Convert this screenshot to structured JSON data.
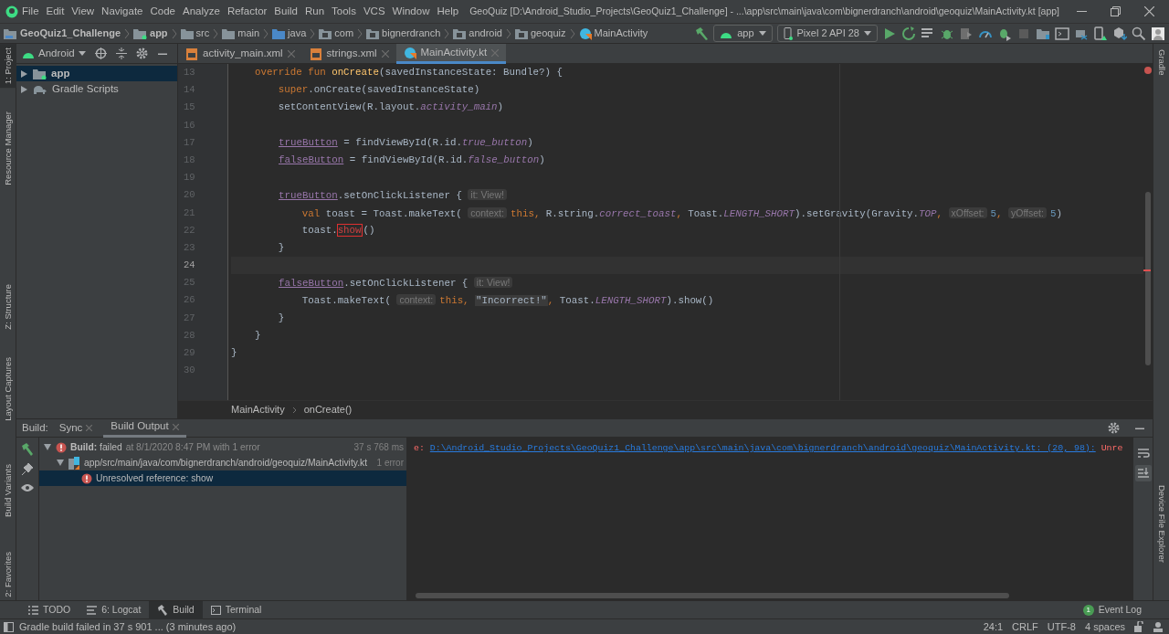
{
  "window": {
    "title": "GeoQuiz [D:\\Android_Studio_Projects\\GeoQuiz1_Challenge] - ...\\app\\src\\main\\java\\com\\bignerdranch\\android\\geoquiz\\MainActivity.kt [app]"
  },
  "menu": [
    "File",
    "Edit",
    "View",
    "Navigate",
    "Code",
    "Analyze",
    "Refactor",
    "Build",
    "Run",
    "Tools",
    "VCS",
    "Window",
    "Help"
  ],
  "navigation_bar": {
    "path": [
      {
        "label": "GeoQuiz1_Challenge",
        "kind": "project"
      },
      {
        "label": "app",
        "kind": "module"
      },
      {
        "label": "src",
        "kind": "folder"
      },
      {
        "label": "main",
        "kind": "folder"
      },
      {
        "label": "java",
        "kind": "source"
      },
      {
        "label": "com",
        "kind": "package"
      },
      {
        "label": "bignerdranch",
        "kind": "package"
      },
      {
        "label": "android",
        "kind": "package"
      },
      {
        "label": "geoquiz",
        "kind": "package"
      },
      {
        "label": "MainActivity",
        "kind": "class"
      }
    ],
    "run_configuration": "app",
    "device": "Pixel 2 API 28"
  },
  "left_tool_windows": [
    {
      "label": "1: Project",
      "selected": true
    },
    {
      "label": "Resource Manager",
      "selected": false
    },
    {
      "label": "Z: Structure",
      "selected": false
    },
    {
      "label": "Layout Captures",
      "selected": false
    },
    {
      "label": "Build Variants",
      "selected": false
    },
    {
      "label": "2: Favorites",
      "selected": false
    }
  ],
  "right_tool_windows": [
    {
      "label": "Gradle"
    },
    {
      "label": "Device File Explorer"
    }
  ],
  "project_panel": {
    "view": "Android",
    "items": [
      {
        "label": "app",
        "kind": "module",
        "selected": true
      },
      {
        "label": "Gradle Scripts",
        "kind": "gradle",
        "selected": false
      }
    ]
  },
  "editor_tabs": [
    {
      "label": "activity_main.xml",
      "kind": "xml",
      "selected": false
    },
    {
      "label": "strings.xml",
      "kind": "xml",
      "selected": false
    },
    {
      "label": "MainActivity.kt",
      "kind": "kotlin",
      "selected": true
    }
  ],
  "editor": {
    "lines": [
      {
        "number": "13",
        "current": false,
        "tokens": [
          {
            "kind": "kw",
            "text": "    override fun "
          },
          {
            "kind": "fn",
            "text": "onCreate"
          },
          {
            "kind": "plain",
            "text": "(savedInstanceState: Bundle?) {"
          }
        ]
      },
      {
        "number": "14",
        "current": false,
        "tokens": [
          {
            "kind": "kw",
            "text": "        super"
          },
          {
            "kind": "plain",
            "text": ".onCreate(savedInstanceState)"
          }
        ]
      },
      {
        "number": "15",
        "current": false,
        "tokens": [
          {
            "kind": "plain",
            "text": "        setContentView(R.layout."
          },
          {
            "kind": "field",
            "text": "activity_main"
          },
          {
            "kind": "plain",
            "text": ")"
          }
        ]
      },
      {
        "number": "16",
        "current": false
      },
      {
        "number": "17",
        "current": false,
        "tokens": [
          {
            "kind": "prop",
            "text": "trueButton"
          },
          {
            "kind": "plain",
            "text": " = findViewById(R.id."
          },
          {
            "kind": "field",
            "text": "true_button"
          },
          {
            "kind": "plain",
            "text": ")"
          }
        ]
      },
      {
        "number": "18",
        "current": false,
        "tokens": [
          {
            "kind": "prop",
            "text": "falseButton"
          },
          {
            "kind": "plain",
            "text": " = findViewById(R.id."
          },
          {
            "kind": "field",
            "text": "false_button"
          },
          {
            "kind": "plain",
            "text": ")"
          }
        ]
      },
      {
        "number": "19",
        "current": false
      },
      {
        "number": "20",
        "current": false,
        "tokens": [
          {
            "kind": "prop",
            "text": "trueButton"
          },
          {
            "kind": "plain",
            "text": ".setOnClickListener { "
          },
          {
            "kind": "hint",
            "text": "it: View!"
          }
        ]
      },
      {
        "number": "21",
        "current": false,
        "tokens": [
          {
            "kind": "kw",
            "text": "            val"
          },
          {
            "kind": "plain",
            "text": " toast = Toast.makeText( "
          },
          {
            "kind": "hint",
            "text": "context:"
          },
          {
            "kind": "kw",
            "text": "this,"
          },
          {
            "kind": "plain",
            "text": " R.string."
          },
          {
            "kind": "field",
            "text": "correct_toast"
          },
          {
            "kind": "kw",
            "text": ","
          },
          {
            "kind": "plain",
            "text": " Toast."
          },
          {
            "kind": "field",
            "text": "LENGTH_SHORT"
          },
          {
            "kind": "plain",
            "text": ").setGravity(Gravity."
          },
          {
            "kind": "field",
            "text": "TOP"
          },
          {
            "kind": "kw",
            "text": ", "
          },
          {
            "kind": "hint",
            "text": "xOffset:"
          },
          {
            "kind": "num",
            "text": "5"
          },
          {
            "kind": "kw",
            "text": ", "
          },
          {
            "kind": "hint",
            "text": "yOffset:"
          },
          {
            "kind": "num",
            "text": "5"
          },
          {
            "kind": "plain",
            "text": ")"
          }
        ]
      },
      {
        "number": "22",
        "current": false,
        "tokens": [
          {
            "kind": "plain",
            "text": "            toast."
          },
          {
            "kind": "error",
            "text": "show"
          },
          {
            "kind": "plain",
            "text": "()"
          }
        ]
      },
      {
        "number": "23",
        "current": false,
        "tokens": [
          {
            "kind": "plain",
            "text": "        }"
          }
        ]
      },
      {
        "number": "24",
        "current": true
      },
      {
        "number": "25",
        "current": false,
        "tokens": [
          {
            "kind": "prop",
            "text": "falseButton"
          },
          {
            "kind": "plain",
            "text": ".setOnClickListener { "
          },
          {
            "kind": "hint",
            "text": "it: View!"
          }
        ]
      },
      {
        "number": "26",
        "current": false,
        "tokens": [
          {
            "kind": "plain",
            "text": "            Toast.makeText( "
          },
          {
            "kind": "hint",
            "text": "context:"
          },
          {
            "kind": "kw",
            "text": "this, "
          },
          {
            "kind": "strhl",
            "text": "\"Incorrect!\""
          },
          {
            "kind": "kw",
            "text": ","
          },
          {
            "kind": "plain",
            "text": " Toast."
          },
          {
            "kind": "field",
            "text": "LENGTH_SHORT"
          },
          {
            "kind": "plain",
            "text": ").show()"
          }
        ]
      },
      {
        "number": "27",
        "current": false,
        "tokens": [
          {
            "kind": "plain",
            "text": "        }"
          }
        ]
      },
      {
        "number": "28",
        "current": false,
        "tokens": [
          {
            "kind": "plain",
            "text": "    }"
          }
        ]
      },
      {
        "number": "29",
        "current": false,
        "tokens": [
          {
            "kind": "plain",
            "text": "}"
          }
        ]
      },
      {
        "number": "30",
        "current": false
      }
    ],
    "breadcrumbs": [
      "MainActivity",
      "onCreate()"
    ]
  },
  "build_panel": {
    "title": "Build:",
    "tabs": [
      {
        "label": "Sync",
        "selected": false
      },
      {
        "label": "Build Output",
        "selected": true
      }
    ],
    "tree": [
      {
        "label": "**Build:** failed",
        "detail": "at 8/1/2020 8:47 PM with 1 error",
        "info": "37 s 768 ms",
        "kind": "error",
        "selected": false,
        "expanded": true,
        "children": [
          {
            "label": "app/src/main/java/com/bignerdranch/android/geoquiz/MainActivity.kt",
            "info": "1 error",
            "kind": "file",
            "selected": false,
            "expanded": true,
            "children": [
              {
                "label": "Unresolved reference: show",
                "kind": "error",
                "selected": true
              }
            ]
          }
        ]
      }
    ],
    "output": {
      "prefix": "e:",
      "link": "D:\\Android_Studio_Projects\\GeoQuiz1_Challenge\\app\\src\\main\\java\\com\\bignerdranch\\android\\geoquiz\\MainActivity.kt: (20, 98):",
      "message": "Unre"
    }
  },
  "bottom_tabs": [
    {
      "label": "TODO",
      "kind": "list",
      "selected": false
    },
    {
      "label": "6: Logcat",
      "kind": "logcat",
      "selected": false
    },
    {
      "label": "Build",
      "kind": "build",
      "selected": true
    },
    {
      "label": "Terminal",
      "kind": "terminal",
      "selected": false
    }
  ],
  "event_log": {
    "count": "1",
    "label": "Event Log"
  },
  "status_bar": {
    "message": "Gradle build failed in 37 s 901 ... (3 minutes ago)",
    "position": "24:1",
    "line_separator": "CRLF",
    "encoding": "UTF-8",
    "indent": "4 spaces"
  }
}
